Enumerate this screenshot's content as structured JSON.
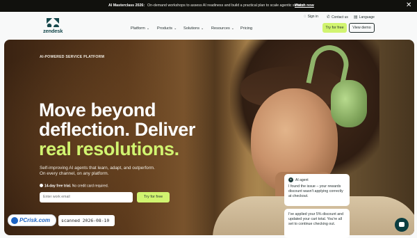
{
  "announcement": {
    "title": "AI Masterclass 2026:",
    "text": "On-demand workshops to assess AI readiness and build a practical plan to scale agentic service.",
    "link": "Watch now",
    "close": "✕"
  },
  "header": {
    "logo_text": "zendesk",
    "util": {
      "sign_in": "Sign in",
      "contact": "Contact us",
      "language": "Language"
    },
    "nav": [
      "Platform",
      "Products",
      "Solutions",
      "Resources",
      "Pricing"
    ],
    "try_free": "Try for free",
    "view_demo": "View demo"
  },
  "hero": {
    "eyebrow": "AI-POWERED SERVICE PLATFORM",
    "headline": [
      "Move beyond",
      "deflection. Deliver",
      "real resolutions."
    ],
    "sub": [
      "Self-improving AI agents that learn, adapt, and outperform.",
      "On every channel, on any platform."
    ],
    "trial_bold": "14-day free trial.",
    "trial_rest": "No credit card required.",
    "email_placeholder": "Enter work email",
    "try_free": "Try for free"
  },
  "chat": {
    "agent_label": "AI agent",
    "msg1": "I found the issue – your rewards discount wasn't applying correctly at checkout.",
    "msg2": "I've applied your 5% discount and updated your cart total. You're all set to continue checking out."
  },
  "watermark": {
    "brand": "PCrisk.com",
    "scanned": "scanned 2026-08-10"
  },
  "colors": {
    "accent": "#d1f470",
    "dark": "#11110d",
    "brand_teal": "#17494d"
  }
}
